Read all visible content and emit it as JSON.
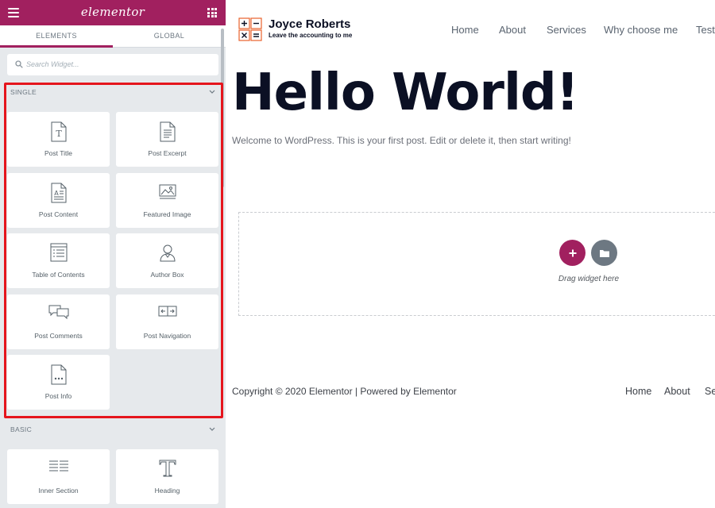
{
  "panel": {
    "logo_text": "elementor",
    "tabs": [
      {
        "label": "ELEMENTS"
      },
      {
        "label": "GLOBAL"
      }
    ],
    "search": {
      "placeholder": "Search Widget..."
    },
    "categories": [
      {
        "title": "SINGLE",
        "widgets": [
          {
            "label": "Post Title",
            "icon": "post-title-icon"
          },
          {
            "label": "Post Excerpt",
            "icon": "post-excerpt-icon"
          },
          {
            "label": "Post Content",
            "icon": "post-content-icon"
          },
          {
            "label": "Featured Image",
            "icon": "featured-image-icon"
          },
          {
            "label": "Table of Contents",
            "icon": "table-of-contents-icon"
          },
          {
            "label": "Author Box",
            "icon": "author-box-icon"
          },
          {
            "label": "Post Comments",
            "icon": "post-comments-icon"
          },
          {
            "label": "Post Navigation",
            "icon": "post-navigation-icon"
          },
          {
            "label": "Post Info",
            "icon": "post-info-icon"
          }
        ]
      },
      {
        "title": "BASIC",
        "widgets": [
          {
            "label": "Inner Section",
            "icon": "inner-section-icon"
          },
          {
            "label": "Heading",
            "icon": "heading-icon"
          }
        ]
      }
    ]
  },
  "site": {
    "title": "Joyce Roberts",
    "tagline": "Leave the accounting to me",
    "nav": [
      {
        "label": "Home"
      },
      {
        "label": "About"
      },
      {
        "label": "Services"
      },
      {
        "label": "Why choose me"
      },
      {
        "label": "Test"
      }
    ]
  },
  "post": {
    "title": "Hello World!",
    "body": "Welcome to WordPress. This is your first post. Edit or delete it, then start writing!"
  },
  "drop_area": {
    "hint": "Drag widget here"
  },
  "footer": {
    "copyright": "Copyright © 2020 Elementor | Powered by Elementor",
    "nav": [
      {
        "label": "Home"
      },
      {
        "label": "About"
      },
      {
        "label": "Se"
      }
    ]
  },
  "colors": {
    "accent": "#a1205f",
    "highlight": "#e5151d",
    "panel_bg": "#e6e9ec",
    "heading": "#0b1024",
    "logo_orange": "#e8622c"
  }
}
